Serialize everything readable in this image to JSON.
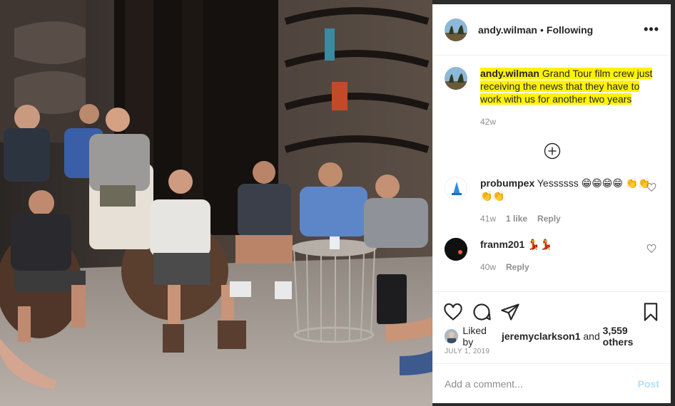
{
  "post": {
    "username": "andy.wilman",
    "separator": "•",
    "follow_status": "Following",
    "more_icon": "more-horizontal-icon"
  },
  "caption": {
    "username": "andy.wilman",
    "text": "Grand Tour film crew just receiving the news that they have to work with us for another two years",
    "time": "42w",
    "highlight_color": "#fff200"
  },
  "comments": [
    {
      "username": "probumpex",
      "text": "Yessssss 😁😁😁😁 👏👏👏👏",
      "time": "41w",
      "likes": "1 like",
      "reply": "Reply"
    },
    {
      "username": "franm201",
      "text": "💃💃",
      "time": "40w",
      "reply": "Reply"
    }
  ],
  "likes": {
    "prefix": "Liked by",
    "user": "jeremyclarkson1",
    "connector": "and",
    "others": "3,559 others"
  },
  "date": "JULY 1, 2019",
  "add_comment": {
    "placeholder": "Add a comment...",
    "post_label": "Post",
    "post_color": "#b2dffc"
  },
  "icons": [
    "heart-icon",
    "comment-icon",
    "share-icon",
    "bookmark-icon",
    "load-more-icon"
  ]
}
